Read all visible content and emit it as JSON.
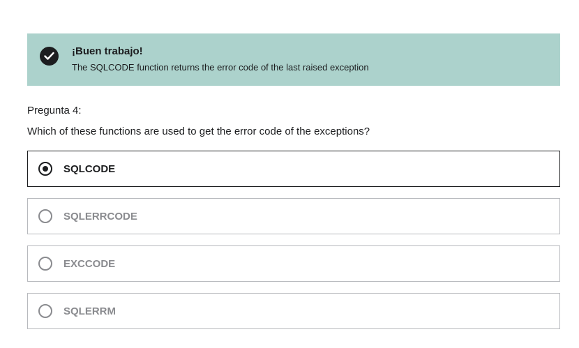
{
  "feedback": {
    "icon": "check-circle-icon",
    "title": "¡Buen trabajo!",
    "message": "The SQLCODE function returns the error code of the last raised exception",
    "background_color": "#acd2cc"
  },
  "question": {
    "label": "Pregunta 4:",
    "text": "Which of these functions are used to get the error code of the exceptions?"
  },
  "options": [
    {
      "label": "SQLCODE",
      "selected": true
    },
    {
      "label": "SQLERRCODE",
      "selected": false
    },
    {
      "label": "EXCCODE",
      "selected": false
    },
    {
      "label": "SQLERRM",
      "selected": false
    }
  ]
}
